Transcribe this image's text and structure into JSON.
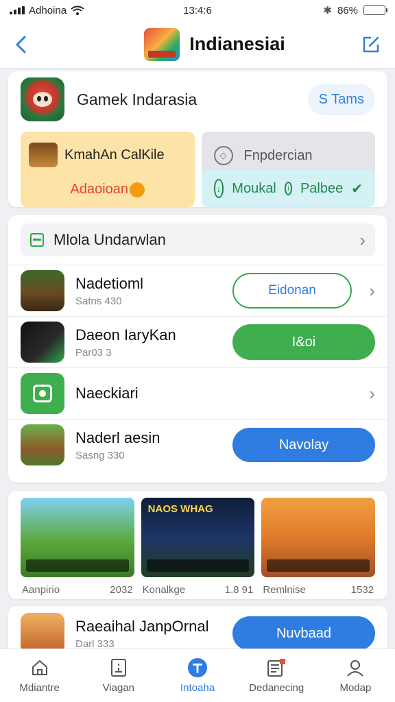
{
  "status_bar": {
    "carrier": "Adhoina",
    "time": "13:4:6",
    "battery": "86%",
    "battery_level": 0.86
  },
  "header": {
    "title": "Indianesiai"
  },
  "featured": {
    "name": "Gamek Indarasia",
    "action_label": "S Tams",
    "tile_left": {
      "title": "KmahAn CalKile",
      "footer": "Adaoioan"
    },
    "tile_right": {
      "title": "Fnpdercian",
      "footer": "Moukal",
      "footer_suffix": "Palbee"
    }
  },
  "list_section": {
    "title": "Mlola Undarwlan",
    "items": [
      {
        "name": "Nadetioml",
        "sub": "Satns 430",
        "button": "Eidonan"
      },
      {
        "name": "Daeon IaryKan",
        "sub": "Par03 3",
        "button": "I&oi"
      },
      {
        "name": "Naeckiari"
      },
      {
        "name": "Naderl aesin",
        "sub": "Sasng 330",
        "button": "Navolay"
      }
    ]
  },
  "gallery": {
    "items": [
      {
        "caption": "Aanpirio",
        "count": "2032",
        "title_text": ""
      },
      {
        "caption": "Konalkge",
        "count": "1.8 91",
        "title_text": "NAOS WHAG"
      },
      {
        "caption": "Remlnise",
        "count": "1532",
        "title_text": ""
      }
    ]
  },
  "bottom_item": {
    "name": "Raeaihal JanpOrnal",
    "sub": "Darl 333",
    "button": "Nuvbaad"
  },
  "tabbar": {
    "tabs": [
      {
        "label": "Mdiantre",
        "icon": "home-icon"
      },
      {
        "label": "Viagan",
        "icon": "document-icon"
      },
      {
        "label": "Intoaha",
        "icon": "download-icon"
      },
      {
        "label": "Dedanecing",
        "icon": "news-icon"
      },
      {
        "label": "Modap",
        "icon": "profile-icon"
      }
    ],
    "active_index": 2
  },
  "colors": {
    "accent_blue": "#2f7de1",
    "accent_green": "#3fae4f",
    "tile_orange": "#fde3a8"
  }
}
